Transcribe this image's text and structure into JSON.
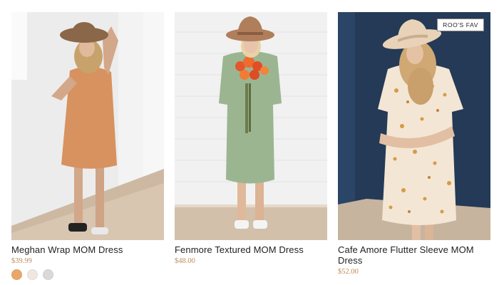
{
  "products": [
    {
      "name": "Meghan Wrap MOM Dress",
      "price": "$39.99",
      "swatches": [
        {
          "color": "#e9a86a"
        },
        {
          "color": "#f1e7df"
        },
        {
          "color": "#d9d9d9"
        }
      ]
    },
    {
      "name": "Fenmore Textured MOM Dress",
      "price": "$48.00"
    },
    {
      "name": "Cafe Amore Flutter Sleeve MOM Dress",
      "price": "$52.00",
      "badge": "ROO'S FAV"
    }
  ]
}
